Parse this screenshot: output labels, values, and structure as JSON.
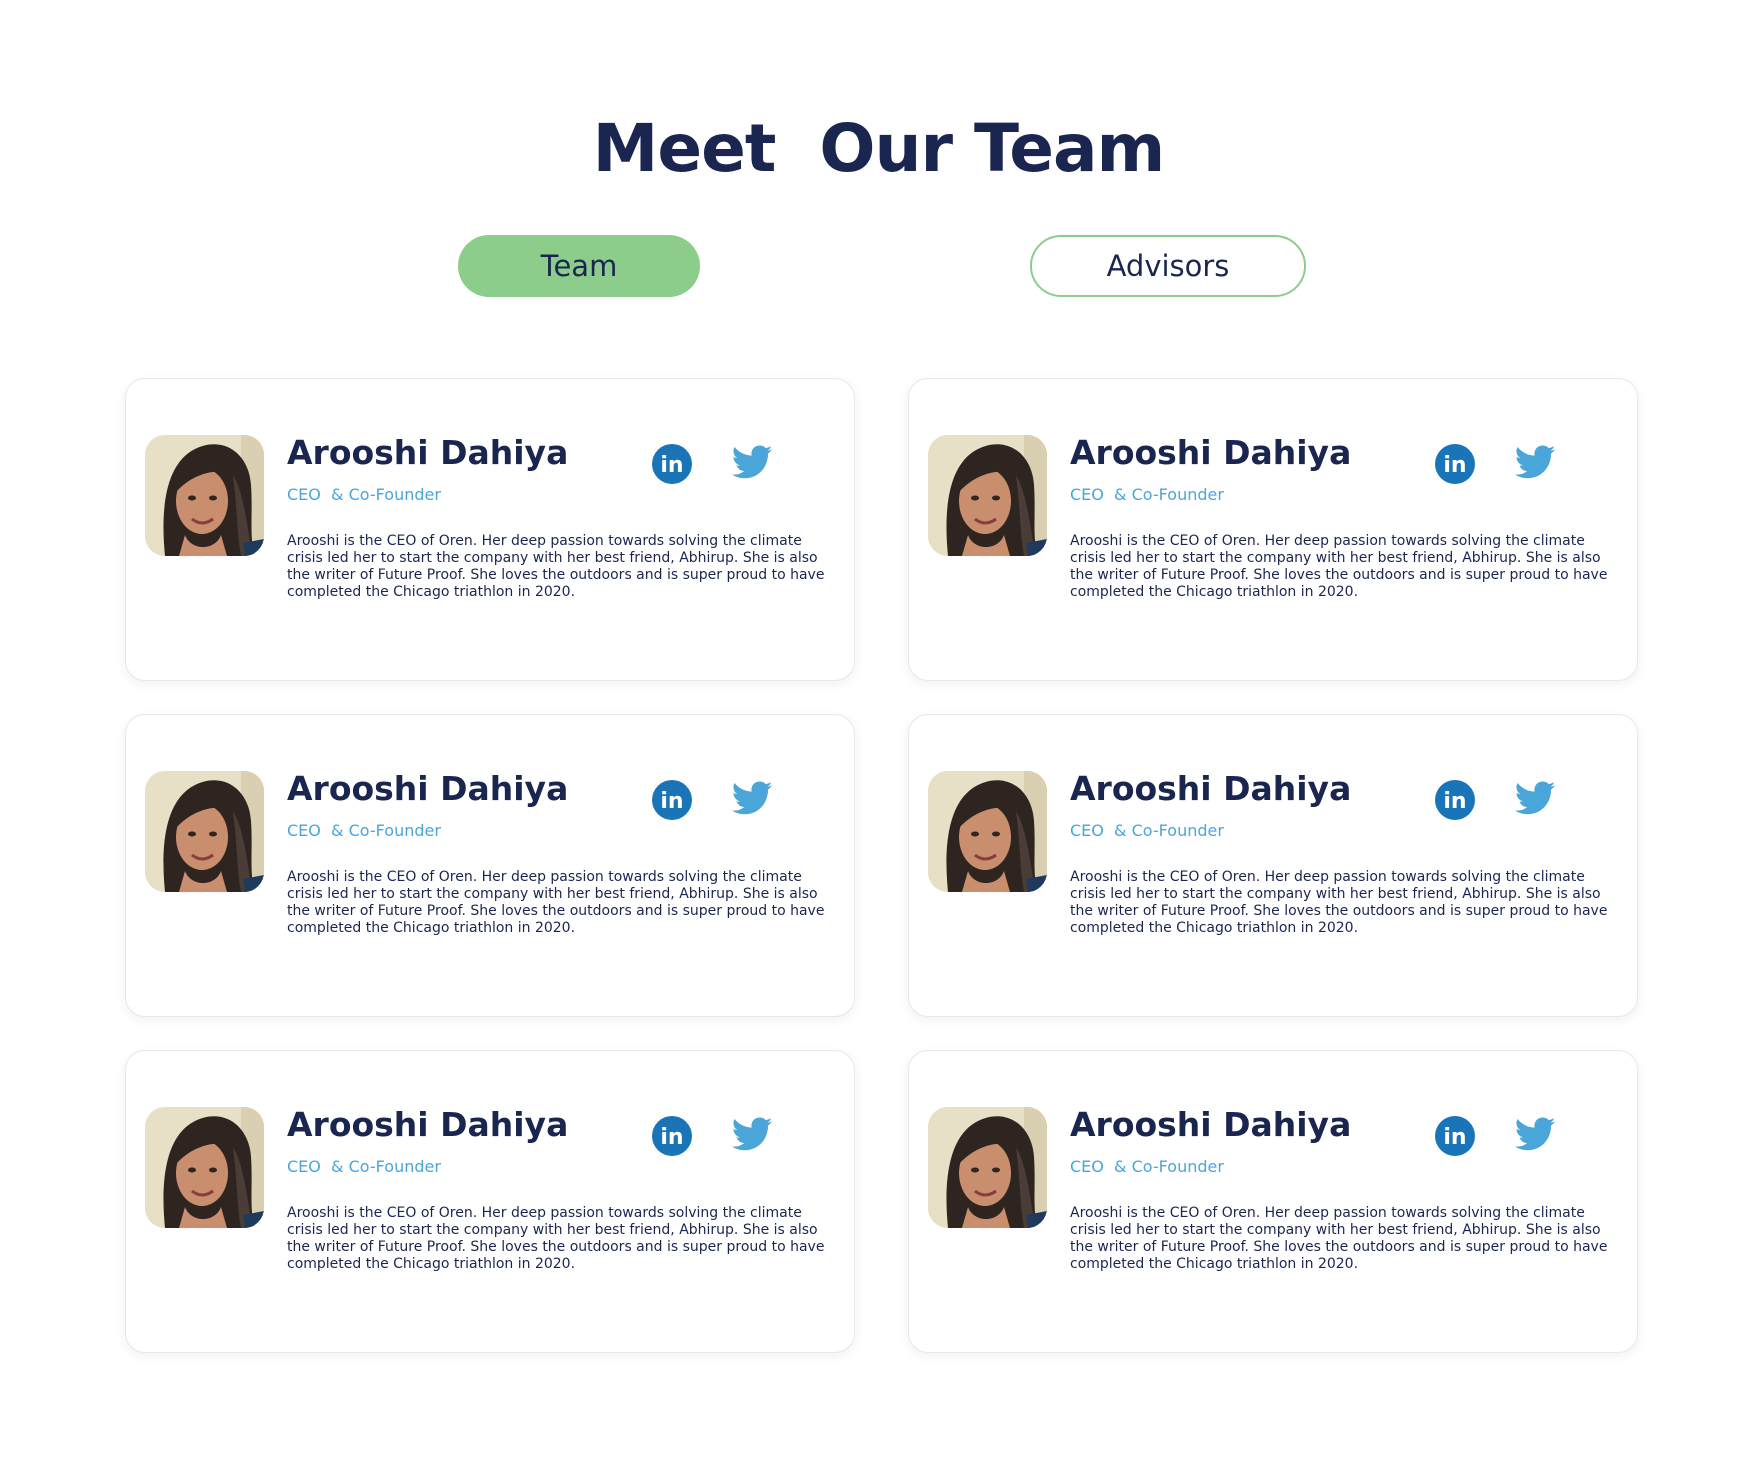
{
  "page": {
    "title": "Meet  Our Team"
  },
  "tabs": [
    {
      "label": "Team",
      "active": true
    },
    {
      "label": "Advisors",
      "active": false
    }
  ],
  "colors": {
    "title": "#1a2650",
    "accent_green": "#8ccd8c",
    "role_blue": "#4aa6d9",
    "linkedin": "#1a74b8",
    "twitter": "#4aa6d9"
  },
  "members": [
    {
      "name": "Arooshi Dahiya",
      "role": "CEO  & Co-Founder",
      "bio": "Arooshi is the CEO of Oren. Her deep passion towards solving the climate crisis led her to start the company with her best friend, Abhirup. She is also the writer of Future Proof. She loves the outdoors and is super proud to have completed the Chicago triathlon in 2020.",
      "icons": [
        "linkedin-icon",
        "twitter-icon"
      ]
    },
    {
      "name": "Arooshi Dahiya",
      "role": "CEO  & Co-Founder",
      "bio": "Arooshi is the CEO of Oren. Her deep passion towards solving the climate crisis led her to start the company with her best friend, Abhirup. She is also the writer of Future Proof. She loves the outdoors and is super proud to have completed the Chicago triathlon in 2020.",
      "icons": [
        "linkedin-icon",
        "twitter-icon"
      ]
    },
    {
      "name": "Arooshi Dahiya",
      "role": "CEO  & Co-Founder",
      "bio": "Arooshi is the CEO of Oren. Her deep passion towards solving the climate crisis led her to start the company with her best friend, Abhirup. She is also the writer of Future Proof. She loves the outdoors and is super proud to have completed the Chicago triathlon in 2020.",
      "icons": [
        "linkedin-icon",
        "twitter-icon"
      ]
    },
    {
      "name": "Arooshi Dahiya",
      "role": "CEO  & Co-Founder",
      "bio": "Arooshi is the CEO of Oren. Her deep passion towards solving the climate crisis led her to start the company with her best friend, Abhirup. She is also the writer of Future Proof. She loves the outdoors and is super proud to have completed the Chicago triathlon in 2020.",
      "icons": [
        "linkedin-icon",
        "twitter-icon"
      ]
    },
    {
      "name": "Arooshi Dahiya",
      "role": "CEO  & Co-Founder",
      "bio": "Arooshi is the CEO of Oren. Her deep passion towards solving the climate crisis led her to start the company with her best friend, Abhirup. She is also the writer of Future Proof. She loves the outdoors and is super proud to have completed the Chicago triathlon in 2020.",
      "icons": [
        "linkedin-icon",
        "twitter-icon"
      ]
    },
    {
      "name": "Arooshi Dahiya",
      "role": "CEO  & Co-Founder",
      "bio": "Arooshi is the CEO of Oren. Her deep passion towards solving the climate crisis led her to start the company with her best friend, Abhirup. She is also the writer of Future Proof. She loves the outdoors and is super proud to have completed the Chicago triathlon in 2020.",
      "icons": [
        "linkedin-icon",
        "twitter-icon"
      ]
    }
  ]
}
